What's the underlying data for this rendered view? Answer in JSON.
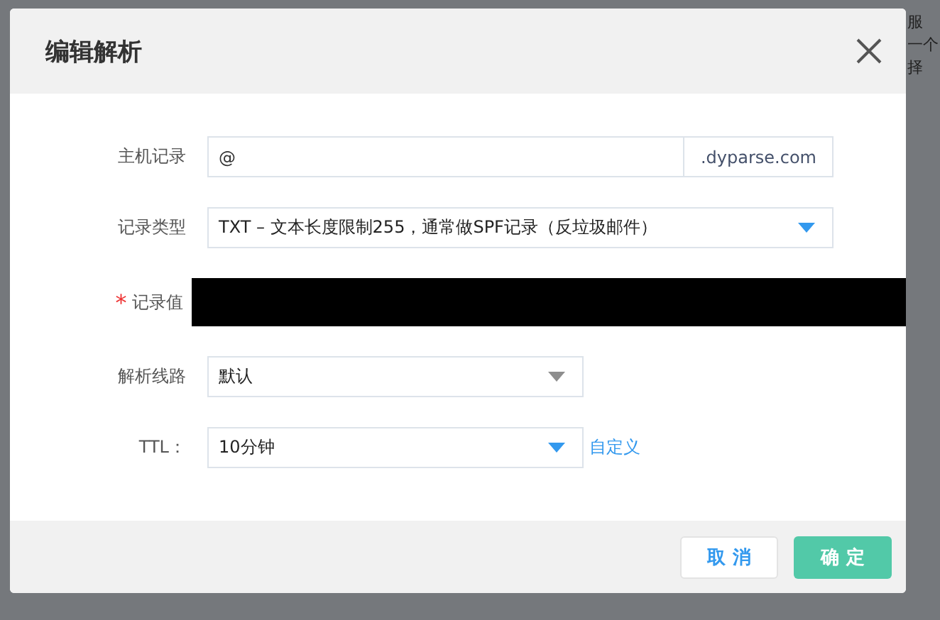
{
  "background": {
    "texts": [
      "服",
      "一个",
      "择"
    ]
  },
  "dialog": {
    "title": "编辑解析",
    "fields": [
      {
        "kind": "input",
        "label": "主机记录",
        "value": "@",
        "suffix": ".dyparse.com"
      },
      {
        "kind": "select",
        "label": "记录类型",
        "value": "TXT – 文本长度限制255，通常做SPF记录（反垃圾邮件）",
        "disabled": false
      },
      {
        "kind": "redacted",
        "label": "记录值",
        "required_mark": "*"
      },
      {
        "kind": "select",
        "label": "解析线路",
        "value": "默认",
        "disabled": true
      },
      {
        "kind": "select",
        "label": "TTL：",
        "value": "10分钟",
        "disabled": false,
        "link": "自定义"
      }
    ],
    "buttons": [
      {
        "kind": "secondary",
        "label": "取 消"
      },
      {
        "kind": "primary",
        "label": "确 定"
      }
    ]
  }
}
